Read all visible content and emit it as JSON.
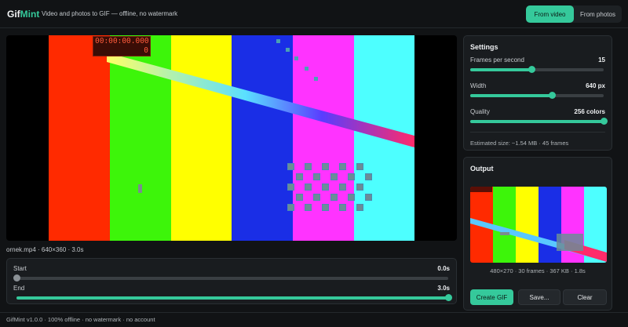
{
  "app": {
    "logo_main": "Gif",
    "logo_accent": "Mint",
    "tagline": "Video and photos to GIF — offline, no watermark"
  },
  "tabs": [
    {
      "label": "From video",
      "active": true
    },
    {
      "label": "From photos",
      "active": false
    }
  ],
  "preview": {
    "timecode": "00:00:00.000",
    "frame": "0",
    "bar_colors": [
      "#ff2a00",
      "#3df50a",
      "#ffff00",
      "#1a2ee6",
      "#ff33ff",
      "#4dffff"
    ]
  },
  "file_info": "ornek.mp4 · 640×360 · 3.0s",
  "trim": {
    "start": {
      "label": "Start",
      "value": "0.0s",
      "fraction": 0
    },
    "end": {
      "label": "End",
      "value": "3.0s",
      "fraction": 1
    }
  },
  "settings": {
    "title": "Settings",
    "fps": {
      "label": "Frames per second",
      "value": "15",
      "fraction": 0.46
    },
    "width": {
      "label": "Width",
      "value": "640 px",
      "fraction": 0.61
    },
    "quality": {
      "label": "Quality",
      "value": "256 colors",
      "fraction": 1
    },
    "estimate": "Estimated size: ~1.54 MB · 45 frames"
  },
  "output": {
    "title": "Output",
    "info": "480×270 · 30 frames · 367 KB · 1.8s"
  },
  "actions": {
    "create": "Create GIF",
    "save": "Save...",
    "clear": "Clear"
  },
  "footer": {
    "text": "GifMint v1.0.0 · 100% offline · no watermark · no account"
  },
  "colors": {
    "accent": "#35c99b",
    "background": "#111315",
    "panel": "#191c1f"
  }
}
